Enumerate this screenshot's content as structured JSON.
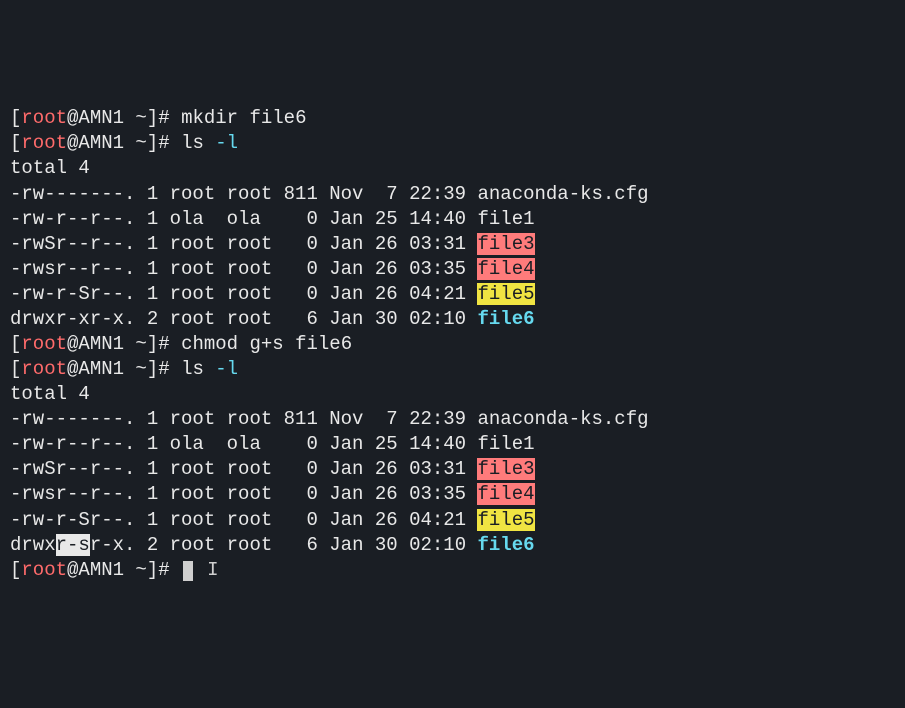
{
  "prompt": {
    "open": "[",
    "user": "root",
    "at": "@",
    "host": "AMN1",
    "space_tilde": " ~",
    "close": "]# "
  },
  "cmds": {
    "c1": "mkdir file6",
    "c2a": "ls ",
    "c2b": "-l",
    "c3": "chmod g+s file6",
    "c4a": "ls ",
    "c4b": "-l"
  },
  "totals": {
    "t1": "total 4",
    "t2": "total 4"
  },
  "ls1": {
    "r0": {
      "perm": "-rw-------.",
      "meta": " 1 root root 811 Nov  7 22:39 ",
      "name": "anaconda-ks.cfg"
    },
    "r1": {
      "perm": "-rw-r--r--.",
      "meta": " 1 ola  ola    0 Jan 25 14:40 ",
      "name": "file1"
    },
    "r2": {
      "perm": "-rwSr--r--.",
      "meta": " 1 root root   0 Jan 26 03:31 ",
      "name": "file3"
    },
    "r3": {
      "perm": "-rwsr--r--.",
      "meta": " 1 root root   0 Jan 26 03:35 ",
      "name": "file4"
    },
    "r4": {
      "perm": "-rw-r-Sr--.",
      "meta": " 1 root root   0 Jan 26 04:21 ",
      "name": "file5"
    },
    "r5": {
      "perm": "drwxr-xr-x.",
      "meta": " 2 root root   6 Jan 30 02:10 ",
      "name": "file6"
    }
  },
  "ls2": {
    "r0": {
      "perm": "-rw-------.",
      "meta": " 1 root root 811 Nov  7 22:39 ",
      "name": "anaconda-ks.cfg"
    },
    "r1": {
      "perm": "-rw-r--r--.",
      "meta": " 1 ola  ola    0 Jan 25 14:40 ",
      "name": "file1"
    },
    "r2": {
      "perm": "-rwSr--r--.",
      "meta": " 1 root root   0 Jan 26 03:31 ",
      "name": "file3"
    },
    "r3": {
      "perm": "-rwsr--r--.",
      "meta": " 1 root root   0 Jan 26 03:35 ",
      "name": "file4"
    },
    "r4": {
      "perm": "-rw-r-Sr--.",
      "meta": " 1 root root   0 Jan 26 04:21 ",
      "name": "file5"
    },
    "r5": {
      "perm_a": "drwx",
      "perm_b": "r-s",
      "perm_c": "r-x.",
      "meta": " 2 root root   6 Jan 30 02:10 ",
      "name": "file6"
    }
  },
  "ibeam": "I"
}
